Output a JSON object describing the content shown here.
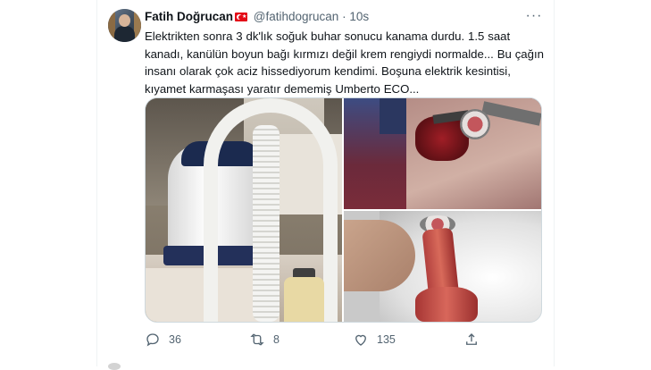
{
  "tweet": {
    "author_name": "Fatih Doğrucan",
    "author_handle": "@fatihdogrucan",
    "separator": "·",
    "time": "10s",
    "text_lines": [
      "Elektrikten sonra 3 dk'lık soğuk buhar sonucu kanama durdu. 1.5 saat",
      "kanadı, kanülün boyun bağı kırmızı değil krem rengiydi normalde...  Bu çağın",
      "insanı olarak çok aciz hissediyorum kendimi. Boşuna elektrik kesintisi,",
      "kıyamet karmaşası yaratır dememiş Umberto ECO..."
    ],
    "more_label": "···",
    "actions": {
      "reply": {
        "icon": "reply-icon",
        "count": "36"
      },
      "retweet": {
        "icon": "retweet-icon",
        "count": "8"
      },
      "like": {
        "icon": "like-icon",
        "count": "135"
      },
      "share": {
        "icon": "share-icon",
        "count": ""
      }
    }
  },
  "colors": {
    "text": "#0f1419",
    "secondary": "#536471",
    "border": "#eff3f4",
    "flag": "#e30a17"
  }
}
